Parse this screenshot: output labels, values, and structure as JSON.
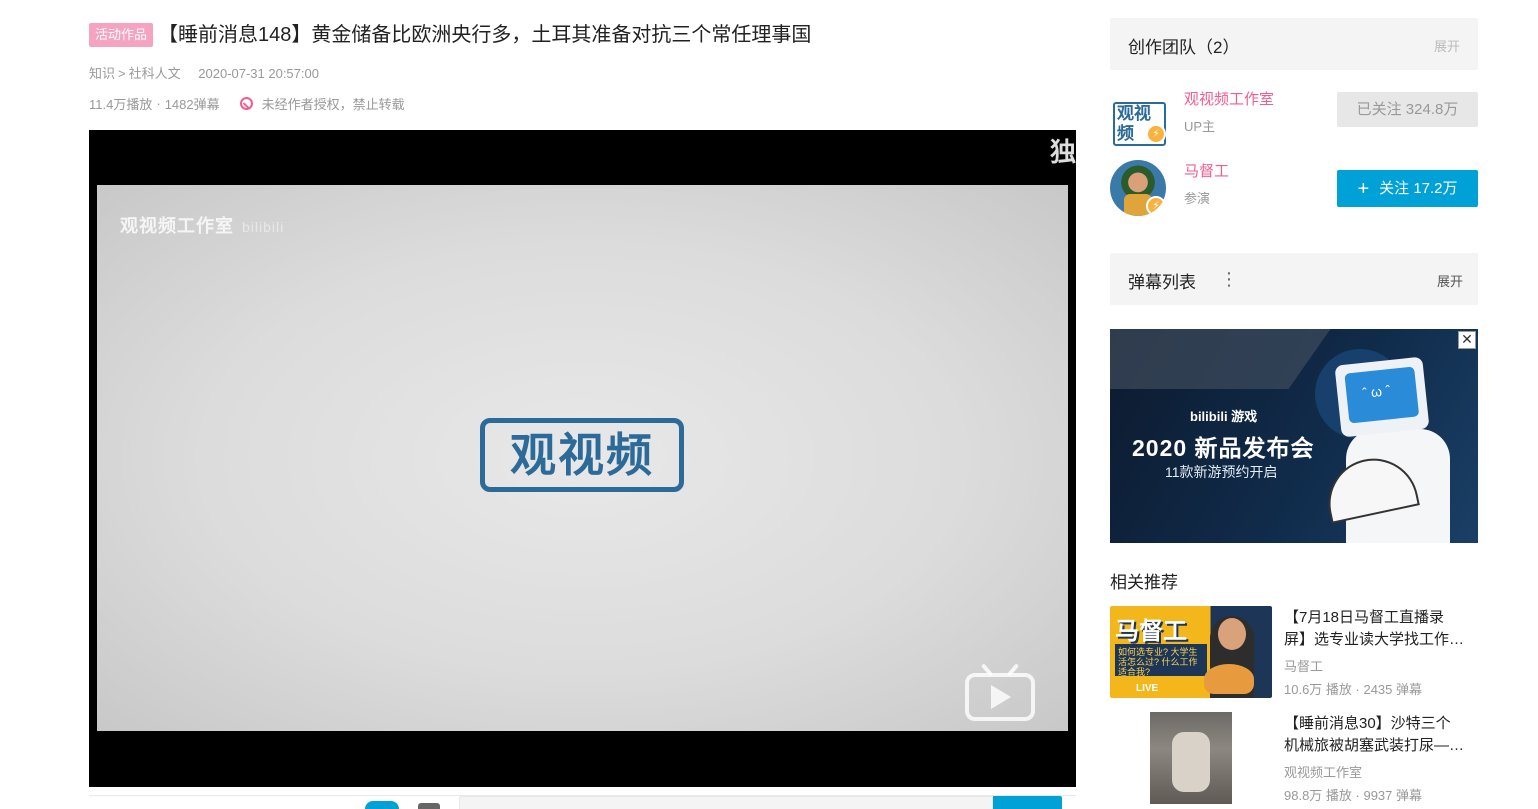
{
  "video": {
    "badge": "活动作品",
    "title": "【睡前消息148】黄金储备比欧洲央行多，土耳其准备对抗三个常任理事国",
    "category": "知识",
    "subcategory": "社科人文",
    "breadcrumb_sep": ">",
    "date": "2020-07-31 20:57:00",
    "plays": "11.4万播放",
    "stats_sep": "·",
    "danmaku_count": "1482弹幕",
    "copyright_notice": "未经作者授权，禁止转载"
  },
  "player": {
    "corner_text": "独",
    "frame_watermark": "观视频工作室",
    "frame_watermark_logo": "bilibili",
    "center_stamp": "观视频"
  },
  "team": {
    "label": "创作团队（2）",
    "expand": "展开",
    "members": [
      {
        "name": "观视频工作室",
        "role": "UP主",
        "avatar_text": "观视频",
        "button": "已关注 324.8万"
      },
      {
        "name": "马督工",
        "role": "参演",
        "button": "关注 17.2万",
        "button_icon": "+"
      }
    ]
  },
  "danmaku_list": {
    "label": "弹幕列表",
    "menu_icon": "⋮",
    "expand": "展开"
  },
  "ad": {
    "close": "✕",
    "brand": "bilibili 游戏",
    "headline": "2020 新品发布会",
    "sub": "11款新游预约开启"
  },
  "related": {
    "title": "相关推荐",
    "items": [
      {
        "title_l1": "【7月18日马督工直播录",
        "title_l2": "屏】选专业读大学找工作…",
        "up": "马督工",
        "stats": "10.6万 播放 · 2435 弹幕",
        "thumb_big": "马督工",
        "thumb_q": "如何选专业? 大学生活怎么过? 什么工作适合我?",
        "thumb_live": "LIVE"
      },
      {
        "title_l1": "【睡前消息30】沙特三个",
        "title_l2": "机械旅被胡塞武装打尿—…",
        "up": "观视频工作室",
        "stats": "98.8万 播放 · 9937 弹幕"
      }
    ]
  },
  "colors": {
    "accent": "#00a1d6",
    "pink": "#f25d8e",
    "badge": "#f6a3c0",
    "stamp_blue": "#2c6b99"
  }
}
